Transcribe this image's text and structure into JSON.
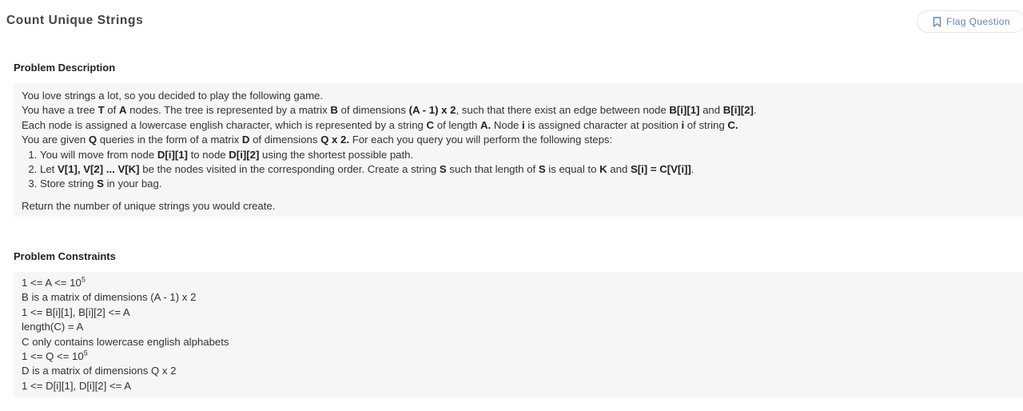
{
  "header": {
    "title": "Count Unique Strings",
    "flag_label": "Flag Question"
  },
  "description": {
    "title": "Problem Description",
    "line1": "You love strings a lot, so you decided to play the following game.",
    "line2_parts": [
      "You have a tree ",
      "T",
      " of ",
      "A",
      " nodes. The tree is represented by a matrix ",
      "B",
      " of dimensions ",
      "(A - 1) x 2",
      ", such that there exist an edge between node ",
      "B[i][1]",
      " and ",
      "B[i][2]",
      "."
    ],
    "line3_parts": [
      "Each node is assigned a lowercase english character, which is represented by a string ",
      "C",
      " of length ",
      "A.",
      " Node ",
      "i",
      " is assigned character at position ",
      "i",
      " of string ",
      "C."
    ],
    "line4_parts": [
      "You are given ",
      "Q",
      " queries in the form of a matrix ",
      "D",
      " of dimensions ",
      "Q x 2.",
      " For each you query you will perform the following steps:"
    ],
    "step1_parts": [
      "You will move from node ",
      "D[i][1]",
      " to node ",
      "D[i][2]",
      " using the shortest possible path."
    ],
    "step2_parts": [
      "Let ",
      "V[1], V[2] ... V[K]",
      " be the nodes visited in the corresponding order. Create a string ",
      "S",
      " such that length of ",
      "S",
      " is equal to ",
      "K",
      " and ",
      "S[i] = C[V[i]]",
      "."
    ],
    "step3_parts": [
      "Store string ",
      "S",
      " in your bag."
    ],
    "closing": "Return the number of unique strings you would create."
  },
  "constraints": {
    "title": "Problem Constraints",
    "c1_base": "1 <= A <= 10",
    "c1_exp": "5",
    "c2": "B is a matrix of dimensions (A - 1) x 2",
    "c3": "1 <= B[i][1], B[i][2] <= A",
    "c4": "length(C) = A",
    "c5": "C only contains lowercase english alphabets",
    "c6_base": "1 <= Q <= 10",
    "c6_exp": "5",
    "c7": "D is a matrix of dimensions Q x 2",
    "c8": "1 <= D[i][1], D[i][2] <= A"
  },
  "colors": {
    "accent": "#5b84c9",
    "box_background": "#f6f6f6"
  }
}
